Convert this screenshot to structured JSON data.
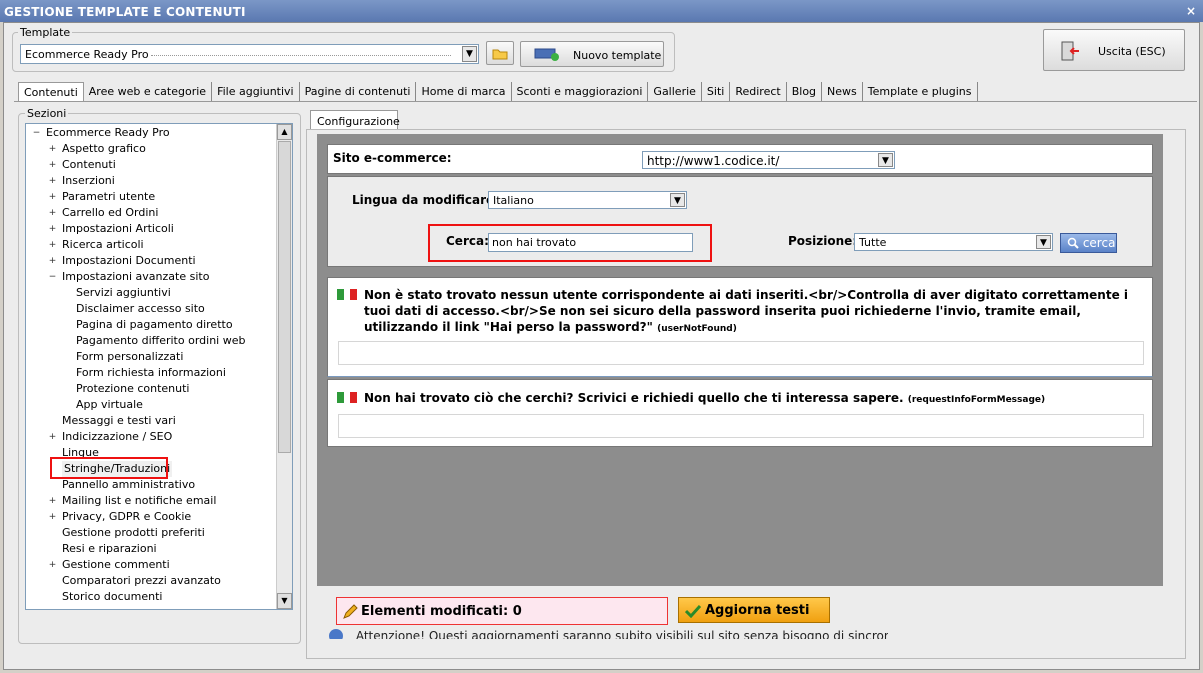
{
  "window": {
    "title": "GESTIONE TEMPLATE E CONTENUTI",
    "close_symbol": "×"
  },
  "template": {
    "group_label": "Template",
    "selected": "Ecommerce Ready Pro",
    "new_button": "Nuovo template"
  },
  "exit_button": "Uscita (ESC)",
  "tabs": [
    "Contenuti",
    "Aree web e categorie",
    "File aggiuntivi",
    "Pagine di contenuti",
    "Home di marca",
    "Sconti e maggiorazioni",
    "Gallerie",
    "Siti",
    "Redirect",
    "Blog",
    "News",
    "Template e plugins"
  ],
  "sections": {
    "label": "Sezioni",
    "tree": [
      {
        "label": "Ecommerce Ready Pro",
        "level": 0,
        "exp": "−"
      },
      {
        "label": "Aspetto grafico",
        "level": 1,
        "exp": "+"
      },
      {
        "label": "Contenuti",
        "level": 1,
        "exp": "+"
      },
      {
        "label": "Inserzioni",
        "level": 1,
        "exp": "+"
      },
      {
        "label": "Parametri utente",
        "level": 1,
        "exp": "+"
      },
      {
        "label": "Carrello ed Ordini",
        "level": 1,
        "exp": "+"
      },
      {
        "label": "Impostazioni Articoli",
        "level": 1,
        "exp": "+"
      },
      {
        "label": "Ricerca articoli",
        "level": 1,
        "exp": "+"
      },
      {
        "label": "Impostazioni Documenti",
        "level": 1,
        "exp": "+"
      },
      {
        "label": "Impostazioni avanzate sito",
        "level": 1,
        "exp": "−"
      },
      {
        "label": "Servizi aggiuntivi",
        "level": 2,
        "exp": ""
      },
      {
        "label": "Disclaimer accesso sito",
        "level": 2,
        "exp": ""
      },
      {
        "label": "Pagina di pagamento diretto",
        "level": 2,
        "exp": ""
      },
      {
        "label": "Pagamento differito ordini web",
        "level": 2,
        "exp": ""
      },
      {
        "label": "Form personalizzati",
        "level": 2,
        "exp": ""
      },
      {
        "label": "Form richiesta informazioni",
        "level": 2,
        "exp": ""
      },
      {
        "label": "Protezione contenuti",
        "level": 2,
        "exp": ""
      },
      {
        "label": "App virtuale",
        "level": 2,
        "exp": ""
      },
      {
        "label": "Messaggi e testi vari",
        "level": 1,
        "exp": ""
      },
      {
        "label": "Indicizzazione / SEO",
        "level": 1,
        "exp": "+"
      },
      {
        "label": "Lingue",
        "level": 1,
        "exp": ""
      },
      {
        "label": "Stringhe/Traduzioni",
        "level": 1,
        "exp": "",
        "selected": true
      },
      {
        "label": "Pannello amministrativo",
        "level": 1,
        "exp": ""
      },
      {
        "label": "Mailing list e notifiche email",
        "level": 1,
        "exp": "+"
      },
      {
        "label": "Privacy, GDPR e Cookie",
        "level": 1,
        "exp": "+"
      },
      {
        "label": "Gestione prodotti preferiti",
        "level": 1,
        "exp": ""
      },
      {
        "label": "Resi e riparazioni",
        "level": 1,
        "exp": ""
      },
      {
        "label": "Gestione commenti",
        "level": 1,
        "exp": "+"
      },
      {
        "label": "Comparatori prezzi avanzato",
        "level": 1,
        "exp": ""
      },
      {
        "label": "Storico documenti",
        "level": 1,
        "exp": ""
      }
    ]
  },
  "config": {
    "tab": "Configurazione",
    "site_label": "Sito e-commerce:",
    "site_value": "http://www1.codice.it/",
    "language_label": "Lingua da modificare:",
    "language_value": "Italiano",
    "search_label": "Cerca:",
    "search_value": "non hai trovato",
    "position_label": "Posizione:",
    "position_value": "Tutte",
    "search_button": "cerca",
    "messages": [
      {
        "text": "Non è stato trovato nessun utente corrispondente ai dati inseriti.<br/>Controlla di aver digitato correttamente i tuoi dati di accesso.<br/>Se non sei sicuro della password inserita puoi richiederne l'invio, tramite email, utilizzando il link \"Hai perso la password?\"",
        "key": "(userNotFound)"
      },
      {
        "text": "Non hai trovato ciò che cerchi? Scrivici e richiedi quello che ti interessa sapere.",
        "key": "(requestInfoFormMessage)"
      }
    ]
  },
  "footer": {
    "modified_label": "Elementi modificati: 0",
    "update_button": "Aggiorna testi",
    "warning": "Attenzione! Questi aggiornamenti saranno subito visibili sul sito senza bisogno di sincronizzare"
  },
  "colors": {
    "accent_red": "#e11111",
    "title_blue": "#5a78b0",
    "highlight_pink": "#fde7ef",
    "update_yellow": "#f5a623"
  }
}
